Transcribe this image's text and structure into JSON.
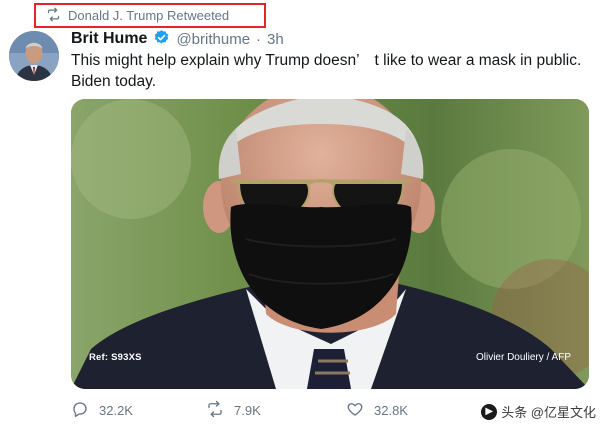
{
  "retweet": {
    "label": "Donald J. Trump Retweeted",
    "icon": "retweet-icon",
    "highlight_color": "#e0262c"
  },
  "author": {
    "display_name": "Brit Hume",
    "handle": "@brithume",
    "separator": "·",
    "time": "3h",
    "verified": true,
    "verified_color": "#1da1f2"
  },
  "tweet": {
    "text": "This might help explain why Trump doesn’　t like to wear a mask in public. Biden today."
  },
  "media": {
    "caption_left": "Ref: S93XS",
    "caption_right": "Olivier Douliery / AFP"
  },
  "actions": {
    "reply_count": "32.2K",
    "retweet_count": "7.9K",
    "like_count": "32.8K"
  },
  "watermark": {
    "text": "头条 @亿星文化",
    "icon": "toutiao-logo-icon"
  },
  "colors": {
    "secondary_text": "#657786",
    "primary_text": "#14171a"
  }
}
